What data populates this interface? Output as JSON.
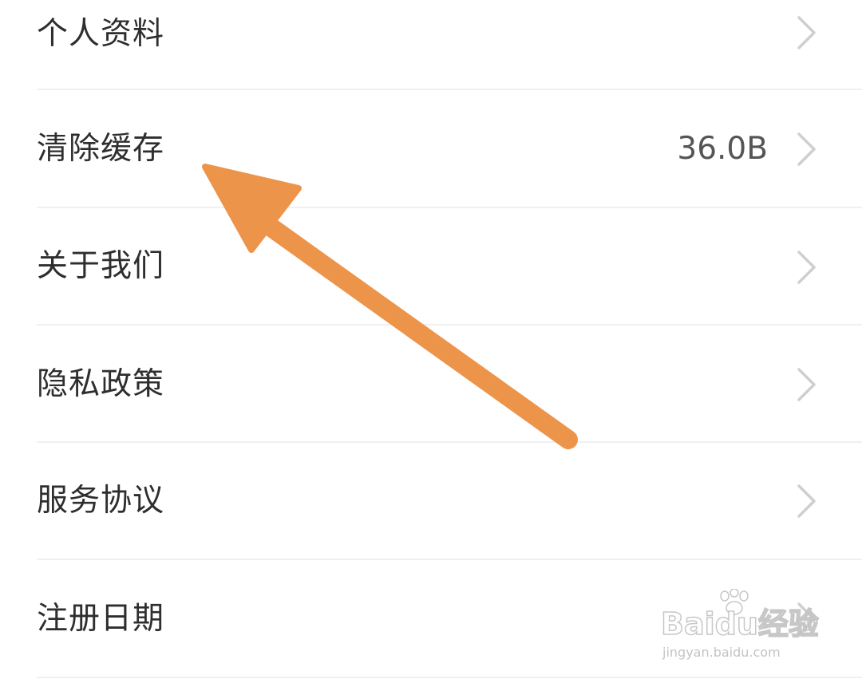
{
  "settings": {
    "items": [
      {
        "label": "个人资料",
        "value": ""
      },
      {
        "label": "清除缓存",
        "value": "36.0B"
      },
      {
        "label": "关于我们",
        "value": ""
      },
      {
        "label": "隐私政策",
        "value": ""
      },
      {
        "label": "服务协议",
        "value": ""
      },
      {
        "label": "注册日期",
        "value": ""
      }
    ]
  },
  "annotation": {
    "arrow_color": "#ED944B",
    "points_to": "清除缓存"
  },
  "watermark": {
    "logo_text": "Baidu经验",
    "url": "jingyan.baidu.com"
  },
  "colors": {
    "label": "#2e2e2e",
    "value": "#555555",
    "chevron": "#cfcfcf",
    "divider": "#f0f0f0",
    "background": "#ffffff"
  },
  "icons": {
    "row_chevron": "chevron-right-icon",
    "watermark_paw": "paw-icon"
  }
}
